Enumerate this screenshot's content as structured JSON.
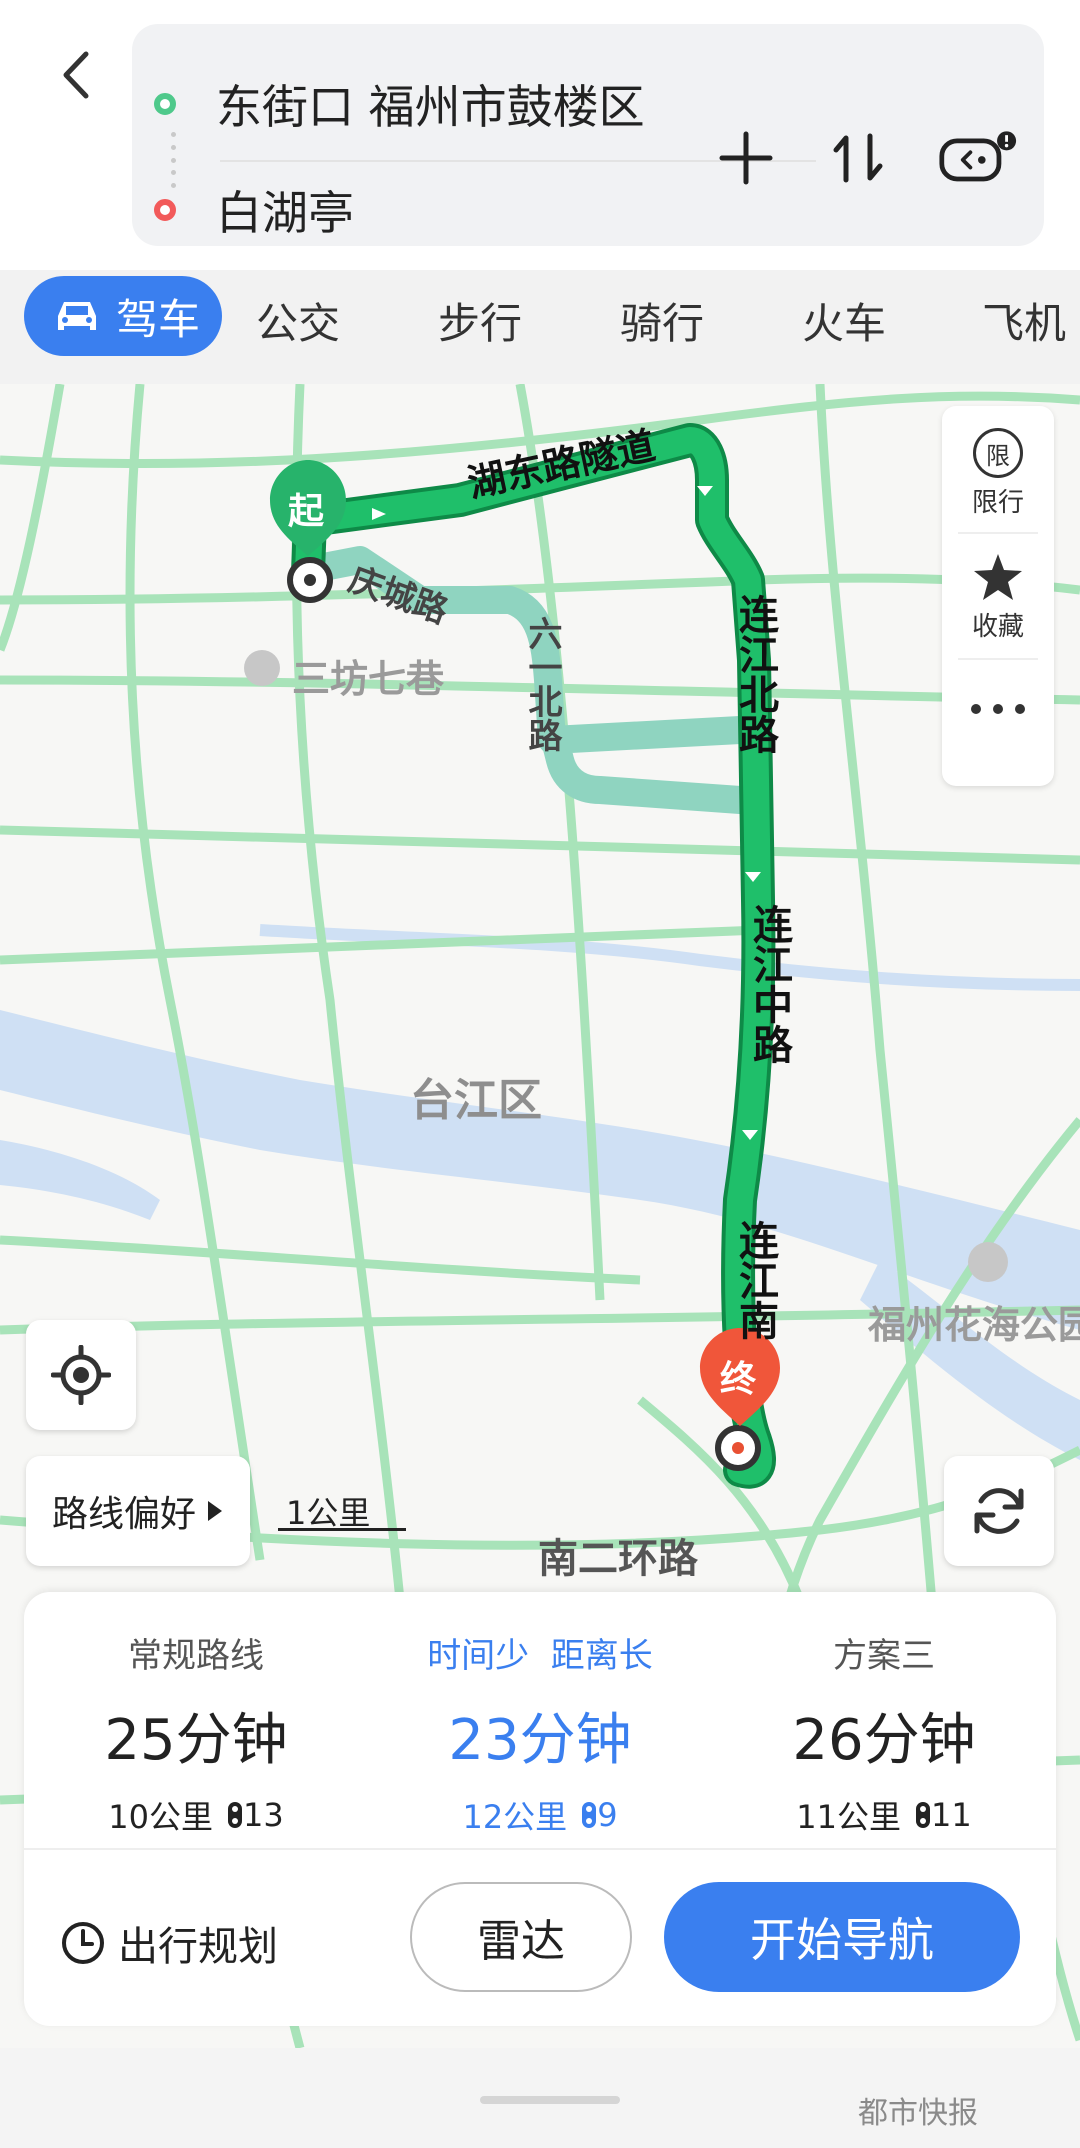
{
  "header": {
    "origin": "东街口 福州市鼓楼区",
    "destination": "白湖亭"
  },
  "mode_tabs": [
    "驾车",
    "公交",
    "步行",
    "骑行",
    "火车",
    "飞机"
  ],
  "map": {
    "start_marker": "起",
    "end_marker": "终",
    "labels": {
      "tunnel": "湖东路隧道",
      "qingcheng": "庆城路",
      "liuyi": "六一北路",
      "lianjiang_north": "连江北路",
      "lianjiang_mid": "连江中路",
      "lianjiang_south": "连江南路",
      "sanfang": "三坊七巷",
      "taijiang": "台江区",
      "huahai": "福州花海公园",
      "ring_road": "南二环路"
    },
    "side_panel": {
      "restrict_icon_text": "限",
      "restrict_label": "限行",
      "favorite_label": "收藏"
    },
    "preference_label": "路线偏好",
    "scale_label": "1公里"
  },
  "routes": [
    {
      "tag": "常规路线",
      "time": "25分钟",
      "distance": "10公里",
      "lights": "13"
    },
    {
      "tag": "时间少  距离长",
      "time": "23分钟",
      "distance": "12公里",
      "lights": "9"
    },
    {
      "tag": "方案三",
      "time": "26分钟",
      "distance": "11公里",
      "lights": "11"
    }
  ],
  "actions": {
    "trip_plan": "出行规划",
    "radar": "雷达",
    "start_navigation": "开始导航"
  },
  "watermark": "都市快报",
  "colors": {
    "accent": "#3a7fef",
    "route_green": "#1fbf6a",
    "start_green": "#27b36b",
    "end_red": "#f0563a"
  }
}
